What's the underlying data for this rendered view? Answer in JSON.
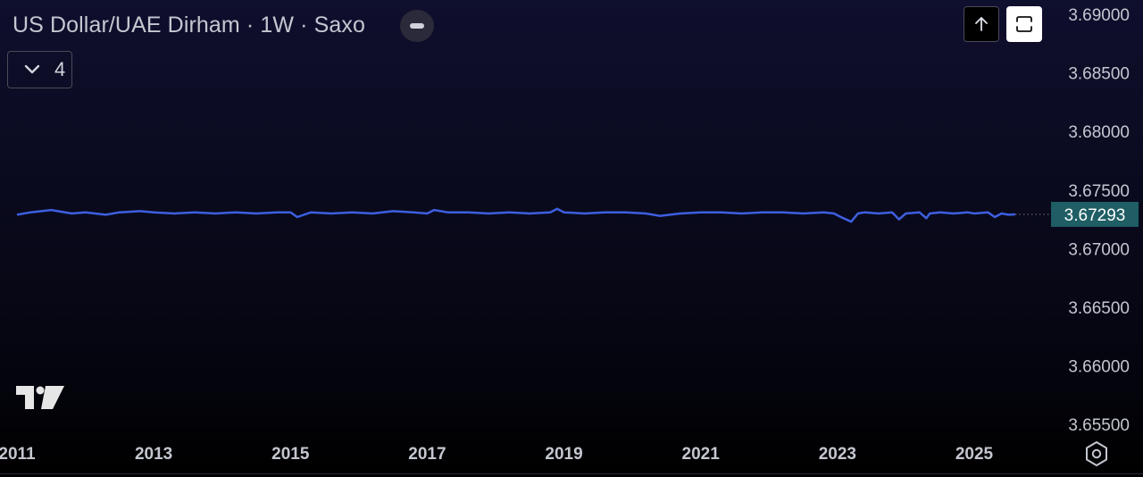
{
  "header": {
    "title": "US Dollar/UAE Dirham · 1W · Saxo",
    "indicator_count": "4"
  },
  "colors": {
    "line": "#3d5fe0",
    "price_label_bg": "#1e5e64",
    "axis_text": "#c4c7d0"
  },
  "icons": [
    "minus-icon",
    "chevron-down-icon",
    "arrow-up-icon",
    "fullscreen-icon",
    "tradingview-logo-icon",
    "settings-icon"
  ],
  "chart_data": {
    "type": "line",
    "series": [
      {
        "x": [
          2011.0,
          2011.2,
          2011.5,
          2011.8,
          2012.0,
          2012.3,
          2012.5,
          2012.8,
          2013.0,
          2013.3,
          2013.6,
          2013.9,
          2014.2,
          2014.5,
          2014.8,
          2015.0,
          2015.1,
          2015.3,
          2015.6,
          2015.9,
          2016.2,
          2016.5,
          2016.8,
          2017.0,
          2017.1,
          2017.3,
          2017.6,
          2017.9,
          2018.2,
          2018.5,
          2018.8,
          2018.9,
          2019.0,
          2019.3,
          2019.6,
          2019.9,
          2020.2,
          2020.4,
          2020.7,
          2021.0,
          2021.3,
          2021.6,
          2021.9,
          2022.2,
          2022.5,
          2022.8,
          2022.95,
          2023.05,
          2023.2,
          2023.3,
          2023.4,
          2023.6,
          2023.8,
          2023.9,
          2024.0,
          2024.2,
          2024.3,
          2024.35,
          2024.5,
          2024.7,
          2024.9,
          2025.0,
          2025.2,
          2025.3,
          2025.4,
          2025.5,
          2025.6
        ],
        "values": [
          3.6729,
          3.6731,
          3.6733,
          3.673,
          3.6731,
          3.6729,
          3.6731,
          3.6732,
          3.6731,
          3.673,
          3.6731,
          3.673,
          3.6731,
          3.673,
          3.6731,
          3.6731,
          3.6727,
          3.6731,
          3.673,
          3.6731,
          3.673,
          3.6732,
          3.6731,
          3.673,
          3.6733,
          3.6731,
          3.6731,
          3.673,
          3.6731,
          3.673,
          3.6731,
          3.6734,
          3.6731,
          3.673,
          3.6731,
          3.6731,
          3.673,
          3.6728,
          3.673,
          3.6731,
          3.6731,
          3.673,
          3.6731,
          3.6731,
          3.673,
          3.6731,
          3.673,
          3.6727,
          3.6723,
          3.673,
          3.6731,
          3.673,
          3.6731,
          3.6725,
          3.673,
          3.6731,
          3.6726,
          3.673,
          3.6731,
          3.673,
          3.6731,
          3.673,
          3.6731,
          3.6727,
          3.673,
          3.6729,
          3.67293
        ]
      }
    ],
    "last_value": "3.67293",
    "xlim": [
      2011.0,
      2026.2
    ],
    "ylim": [
      3.6525,
      3.6915
    ],
    "x_ticks": [
      "2011",
      "2013",
      "2015",
      "2017",
      "2019",
      "2021",
      "2023",
      "2025"
    ],
    "y_ticks": [
      "3.69000",
      "3.68500",
      "3.68000",
      "3.67500",
      "3.67000",
      "3.66500",
      "3.66000",
      "3.65500"
    ],
    "grid": false,
    "legend": "none"
  }
}
